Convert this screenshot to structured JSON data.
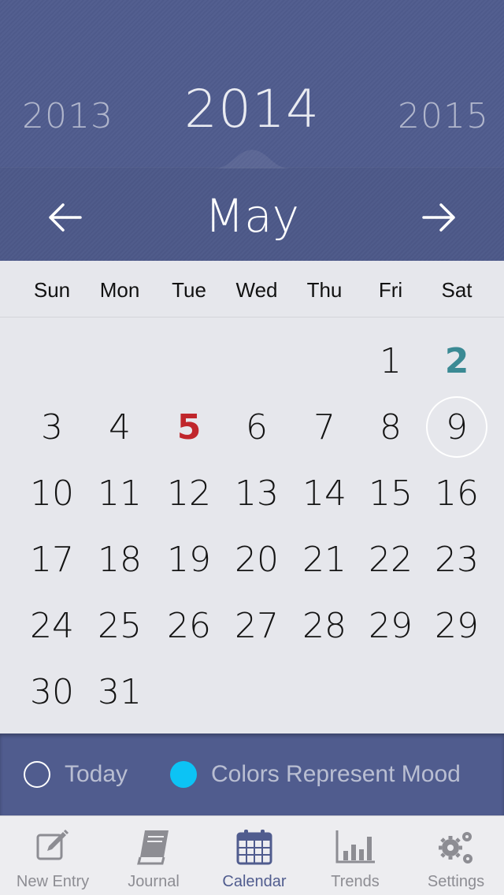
{
  "header": {
    "prev_year": "2013",
    "current_year": "2014",
    "next_year": "2015",
    "month": "May"
  },
  "weekdays": [
    "Sun",
    "Mon",
    "Tue",
    "Wed",
    "Thu",
    "Fri",
    "Sat"
  ],
  "days": {
    "row1": [
      "1",
      "2"
    ],
    "row2": [
      "3",
      "4",
      "5",
      "6",
      "7",
      "8",
      "9"
    ],
    "row3": [
      "10",
      "11",
      "12",
      "13",
      "14",
      "15",
      "16"
    ],
    "row4": [
      "17",
      "18",
      "19",
      "20",
      "21",
      "22",
      "23"
    ],
    "row5": [
      "24",
      "25",
      "26",
      "27",
      "28",
      "29",
      "29"
    ],
    "row6": [
      "30",
      "31"
    ]
  },
  "legend": {
    "today_label": "Today",
    "mood_label": "Colors Represent Mood"
  },
  "tabs": [
    {
      "label": "New Entry",
      "icon": "pencil-edit-icon"
    },
    {
      "label": "Journal",
      "icon": "book-icon"
    },
    {
      "label": "Calendar",
      "icon": "calendar-icon"
    },
    {
      "label": "Trends",
      "icon": "bar-chart-icon"
    },
    {
      "label": "Settings",
      "icon": "gears-icon"
    }
  ],
  "colors": {
    "header_bg": "#505c8e",
    "mood_red": "#c0262c",
    "mood_teal": "#3b8a94",
    "mood_legend": "#0cc3f5",
    "active_tab": "#505c8e"
  }
}
